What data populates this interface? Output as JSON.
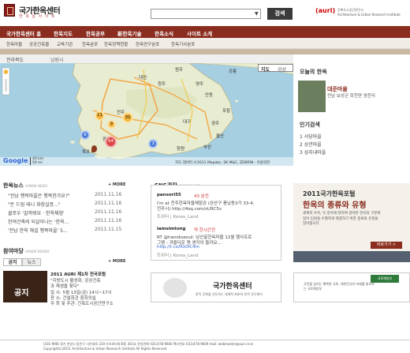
{
  "header": {
    "site_title": "국가한옥센터",
    "site_subtitle": "한 옥 날 사 이 트",
    "search_button": "검색",
    "auri_logo": "(auri)",
    "auri_lines": [
      "건축도시공간연구소",
      "Architecture & Urban Research Institute"
    ]
  },
  "nav": {
    "items": [
      "국가한옥센터 홈",
      "한옥지도",
      "한옥공부",
      "新한옥기술",
      "한옥소식",
      "사이트 소개"
    ]
  },
  "subnav": {
    "items": [
      "한옥마을",
      "공공건축물",
      "교육기관",
      "한옥분포",
      "한옥정책현황",
      "한옥연구분포",
      "한옥기사분포"
    ]
  },
  "breadcrumb": [
    "전라북도",
    "남원시"
  ],
  "map": {
    "type_buttons": [
      "지도",
      "위성"
    ],
    "cluster_counts": [
      "11",
      "30",
      "9",
      "6",
      "3",
      "64"
    ],
    "scale_km": "40 km",
    "scale_mi": "50 mi",
    "attribution": "지도 데이터 ©2011 Mapabc, SK M&C, ZENRIN - 이용약관",
    "city_labels": [
      "대전",
      "청주",
      "전주",
      "광주",
      "대구",
      "울산",
      "부산",
      "창원",
      "목포",
      "포항",
      "경주",
      "안동",
      "원주",
      "강릉",
      "영주"
    ]
  },
  "today": {
    "title": "오늘의 한옥",
    "name": "대준마을",
    "location": "전남 보성군 회천면 영천리"
  },
  "popular": {
    "title": "인기검색",
    "items": [
      "1 서당마을",
      "2 상관마을",
      "3 삼지내마을"
    ]
  },
  "news": {
    "title": "한옥뉴스",
    "title_en": "HANOK NEWS",
    "items": [
      {
        "text": "\"전남 행복마을은 행복한가요?\"",
        "date": "2011.11.16"
      },
      {
        "text": "\"돈 드림 테니 화장실증...\"",
        "date": "2011.11.16"
      },
      {
        "text": "클로우 '갈까봐요 · 한옥체험'",
        "date": "2011.11.16"
      },
      {
        "text": "한여건축비 되살아나는 '한옥...",
        "date": "2011.11.16"
      },
      {
        "text": "'전남 한옥 해설 행복마을' 5...",
        "date": "2011.11.15"
      }
    ],
    "more": "+ MORE"
  },
  "community": {
    "title": "참여마당",
    "title_en": "HANOK BOARD",
    "tabs": [
      "공지",
      "뉴스"
    ],
    "more": "+ MORE",
    "img_text": "공지",
    "post_title": "2011 AURI 제1차 전국포럼",
    "lines": [
      "\"지방도시 활성화, 공공건축",
      "과 재생을 찾다\"",
      "일 시: 5월 13일(금) 14시~17시",
      "장 소: 건설회관 중회의실",
      "주 최 및 주관: 건축도시공간연구소"
    ]
  },
  "sns": {
    "title": "SNS광장",
    "title_en": "SNS SQUARE",
    "posts": [
      {
        "user": "pansori55",
        "time": "43 분전",
        "text": "I'm at 전주한옥마을체험관 (완산구 풍남동3가 33-4,",
        "text2": "전주시) http://4sq.com/sU9C5v",
        "tags": "트위터 | Korea_Land"
      },
      {
        "user": "iamsimtong",
        "time": "약 한시간전",
        "text": "RT @hanokseoul: 남산골한옥마을 12월 행사프로",
        "text2": "그램 - 겨울다운 옛 생각이 들까요...",
        "link": "http://t.co/Rx0IC4m",
        "tags": "트위터 | Korea_Land"
      }
    ]
  },
  "promo": {
    "title": "2011국가한옥포털",
    "subtitle": "한옥의 종류와 유형",
    "body": "세계적 수목, 옥 양옥에 대하여 알아본 한옥의 구분에 있어 민원을 수월하게 해결하기 위한 종류와 유형을 알아봅시다",
    "button": "바로가기 >"
  },
  "banner1": {
    "title": "국가한옥센터",
    "sub": "한옥 건축을 선도하는 세계적 최초의 한옥 연구센터"
  },
  "banner2": {
    "text": "국민을 섬기는 행복한 국토, 대한민국의 미래를 창조하는 국토해양부",
    "logo": "국토해양부"
  },
  "footer": {
    "lines": [
      "[431-998] 경기 안양시 동안구 시민대로 230 아크로타워 B동 301호  문의전화 031)478-9600  팩스번호 031)478-9609  mail: webmaster@auri.re.kr",
      "Copyright(c)2011 Architecture & Urban Research Institute All Rights Reserved."
    ]
  }
}
